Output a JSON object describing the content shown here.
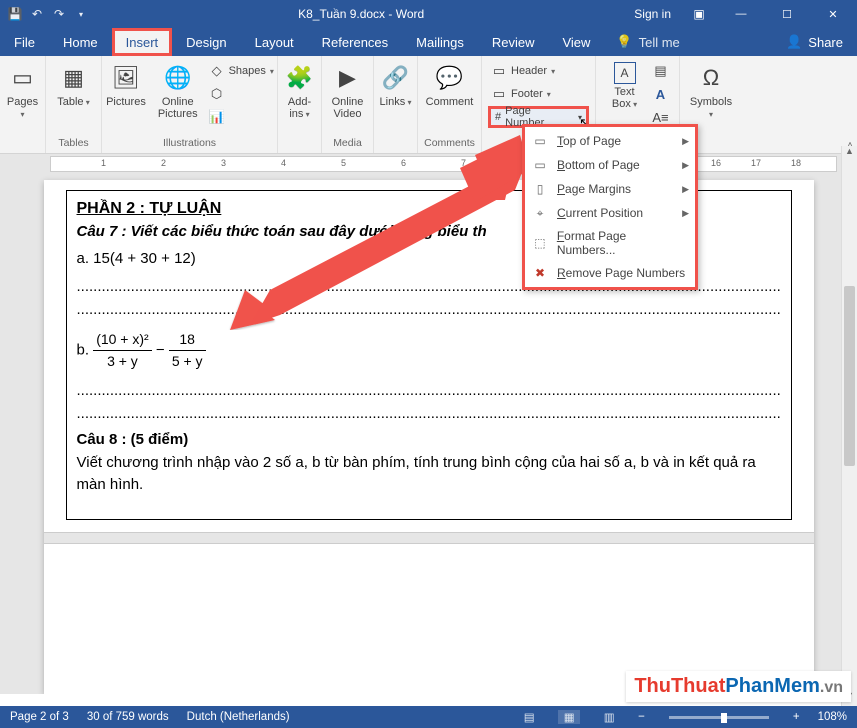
{
  "titlebar": {
    "doc_title": "K8_Tuần 9.docx  -  Word",
    "signin": "Sign in"
  },
  "tabs": {
    "file": "File",
    "home": "Home",
    "insert": "Insert",
    "design": "Design",
    "layout": "Layout",
    "references": "References",
    "mailings": "Mailings",
    "review": "Review",
    "view": "View",
    "tellme": "Tell me",
    "share": "Share"
  },
  "ribbon": {
    "pages": "Pages",
    "table": "Table",
    "tables_grp": "Tables",
    "pictures": "Pictures",
    "online_pictures": "Online\nPictures",
    "shapes": "Shapes",
    "illustrations_grp": "Illustrations",
    "addins": "Add-\nins",
    "online_video": "Online\nVideo",
    "media_grp": "Media",
    "links": "Links",
    "comment": "Comment",
    "comments_grp": "Comments",
    "header": "Header",
    "footer": "Footer",
    "page_number": "Page Number",
    "textbox": "Text\nBox",
    "symbols": "Symbols"
  },
  "page_number_menu": {
    "top": "op of Page",
    "bottom": "ottom of Page",
    "margins": "age Margins",
    "current": "urrent Position",
    "format": "ormat Page Numbers...",
    "remove": "emove Page Numbers"
  },
  "ruler_marks": [
    "1",
    "2",
    "3",
    "4",
    "5",
    "6",
    "7",
    "16",
    "17",
    "18"
  ],
  "document": {
    "section_title": "PHẦN 2 : TỰ LUẬN",
    "q7": "Câu 7 : Viết các biểu thức toán sau đây dưới dạng biểu th",
    "q7a": " a. 15(4 + 30 + 12)",
    "q7b_prefix": "b. ",
    "frac1_num": "(10 + x)²",
    "frac1_den": "3 + y",
    "minus": " − ",
    "frac2_num": "18",
    "frac2_den": "5 + y",
    "q8_title": "Câu 8 : (5 điểm)",
    "q8_body": "Viết chương trình nhập vào 2 số a, b từ bàn phím, tính trung bình cộng của hai số a, b và in kết quả ra màn hình."
  },
  "statusbar": {
    "page": "Page 2 of 3",
    "words": "30 of 759 words",
    "lang": "Dutch (Netherlands)",
    "zoom": "108%"
  },
  "watermark": {
    "a": "ThuThuat",
    "b": "PhanMem",
    "c": ".vn"
  }
}
